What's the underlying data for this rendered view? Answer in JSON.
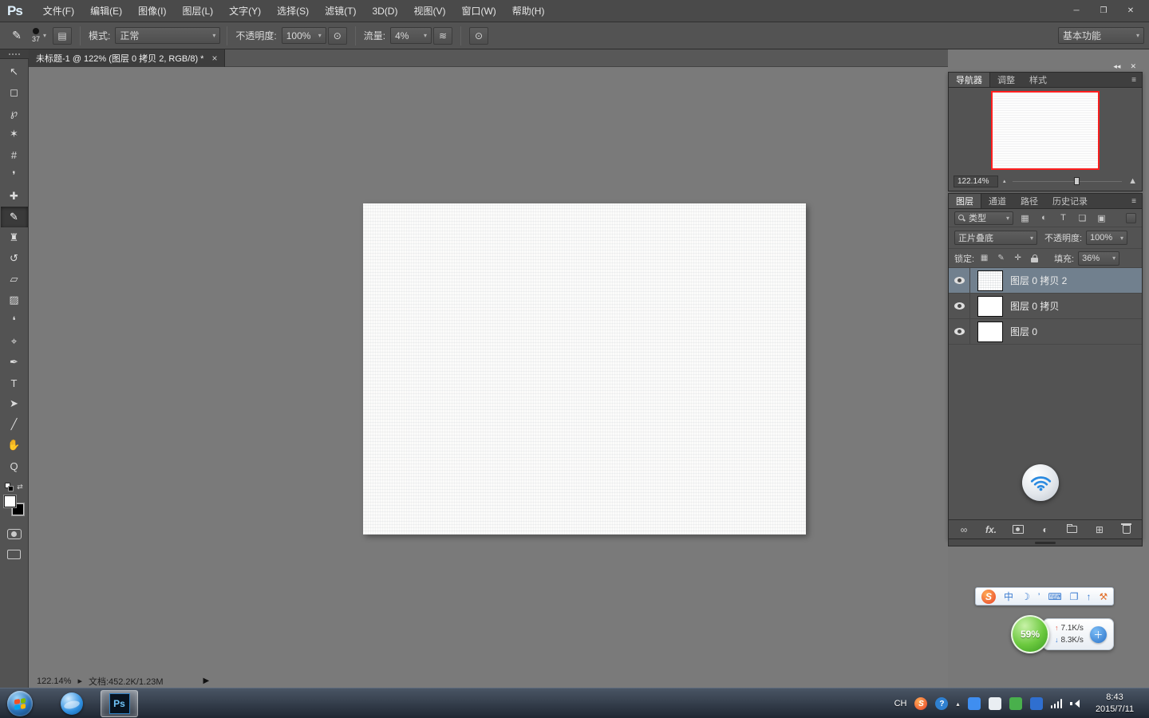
{
  "ui": {
    "arrow": "▾",
    "menu_icon": "≡"
  },
  "window": {
    "logo": "Ps",
    "minimize": "─",
    "restore": "❒",
    "close": "✕"
  },
  "menu": {
    "items": [
      "文件(F)",
      "编辑(E)",
      "图像(I)",
      "图层(L)",
      "文字(Y)",
      "选择(S)",
      "滤镜(T)",
      "3D(D)",
      "视图(V)",
      "窗口(W)",
      "帮助(H)"
    ]
  },
  "options": {
    "tool_glyph": "✎",
    "brush_size": "37",
    "panel_toggle": "▤",
    "mode_label": "模式:",
    "mode_value": "正常",
    "opacity_label": "不透明度:",
    "opacity_value": "100%",
    "pressure_opacity": "⊙",
    "flow_label": "流量:",
    "flow_value": "4%",
    "airbrush": "≋",
    "pressure_size": "⊙",
    "workspace": "基本功能"
  },
  "doc_tab": {
    "title": "未标题-1 @ 122% (图层 0 拷贝 2, RGB/8) *",
    "close": "×"
  },
  "tools": [
    {
      "label": "移动工具",
      "glyph": "↖"
    },
    {
      "label": "矩形选框工具",
      "glyph": "◻"
    },
    {
      "label": "套索工具",
      "glyph": "℘"
    },
    {
      "label": "快速选择工具",
      "glyph": "✶"
    },
    {
      "label": "裁剪工具",
      "glyph": "#"
    },
    {
      "label": "吸管工具",
      "glyph": "❜"
    },
    {
      "label": "污点修复画笔工具",
      "glyph": "✚"
    },
    {
      "label": "画笔工具",
      "glyph": "✎"
    },
    {
      "label": "仿制图章工具",
      "glyph": "♜"
    },
    {
      "label": "历史记录画笔工具",
      "glyph": "↺"
    },
    {
      "label": "橡皮擦工具",
      "glyph": "▱"
    },
    {
      "label": "渐变工具",
      "glyph": "▨"
    },
    {
      "label": "模糊工具",
      "glyph": "❛"
    },
    {
      "label": "减淡工具",
      "glyph": "⌖"
    },
    {
      "label": "钢笔工具",
      "glyph": "✒"
    },
    {
      "label": "横排文字工具",
      "glyph": "T"
    },
    {
      "label": "路径选择工具",
      "glyph": "➤"
    },
    {
      "label": "直线工具",
      "glyph": "╱"
    },
    {
      "label": "抓手工具",
      "glyph": "✋"
    },
    {
      "label": "缩放工具",
      "glyph": "Q"
    }
  ],
  "toolbar_extras": {
    "swap": "⇄"
  },
  "dock": {
    "collapse": "◂◂",
    "close": "✕"
  },
  "navigator": {
    "tabs": [
      "导航器",
      "调整",
      "样式"
    ],
    "zoom": "122.14%",
    "small_mountain": "▴",
    "large_mountain": "▲"
  },
  "layers": {
    "tabs": [
      "图层",
      "通道",
      "路径",
      "历史记录"
    ],
    "filter_label": "类型",
    "filter_icons": [
      "▦",
      "◐",
      "T",
      "❏",
      "▣"
    ],
    "blend_mode": "正片叠底",
    "opacity_label": "不透明度:",
    "opacity_value": "100%",
    "lock_label": "锁定:",
    "lock_icons": [
      "▦",
      "✎",
      "✛"
    ],
    "fill_label": "填充:",
    "fill_value": "36%",
    "rows": [
      {
        "name": "图层 0 拷贝 2",
        "selected": true
      },
      {
        "name": "图层 0 拷贝",
        "selected": false
      },
      {
        "name": "图层 0",
        "selected": false
      }
    ],
    "footer": {
      "link": "∞",
      "fx": "fx.",
      "adjust": "◐",
      "new_layer": "⊞"
    }
  },
  "status": {
    "zoom": "122.14%",
    "flyout": "▸",
    "doc_label": "文档:452.2K/1.23M",
    "arrow": "▶"
  },
  "sogou": {
    "logo": "S",
    "icons": [
      "中",
      "☽",
      "’",
      "⌨",
      "❐",
      "↑",
      "⚒"
    ]
  },
  "speed": {
    "percent": "59%",
    "up_arrow": "↑",
    "up": "7.1K/s",
    "down_arrow": "↓",
    "down": "8.3K/s",
    "plus": "＋"
  },
  "taskbar": {
    "language": "CH",
    "sogou": "S",
    "help": "?",
    "expand": "▴",
    "time": "8:43",
    "date": "2015/7/11"
  },
  "colors": {
    "accent_blue": "#31a8ff",
    "layer_selection": "#71808e",
    "navigator_proxy_border": "#ff1f1f",
    "speed_ball_green": "#6cc93f"
  }
}
